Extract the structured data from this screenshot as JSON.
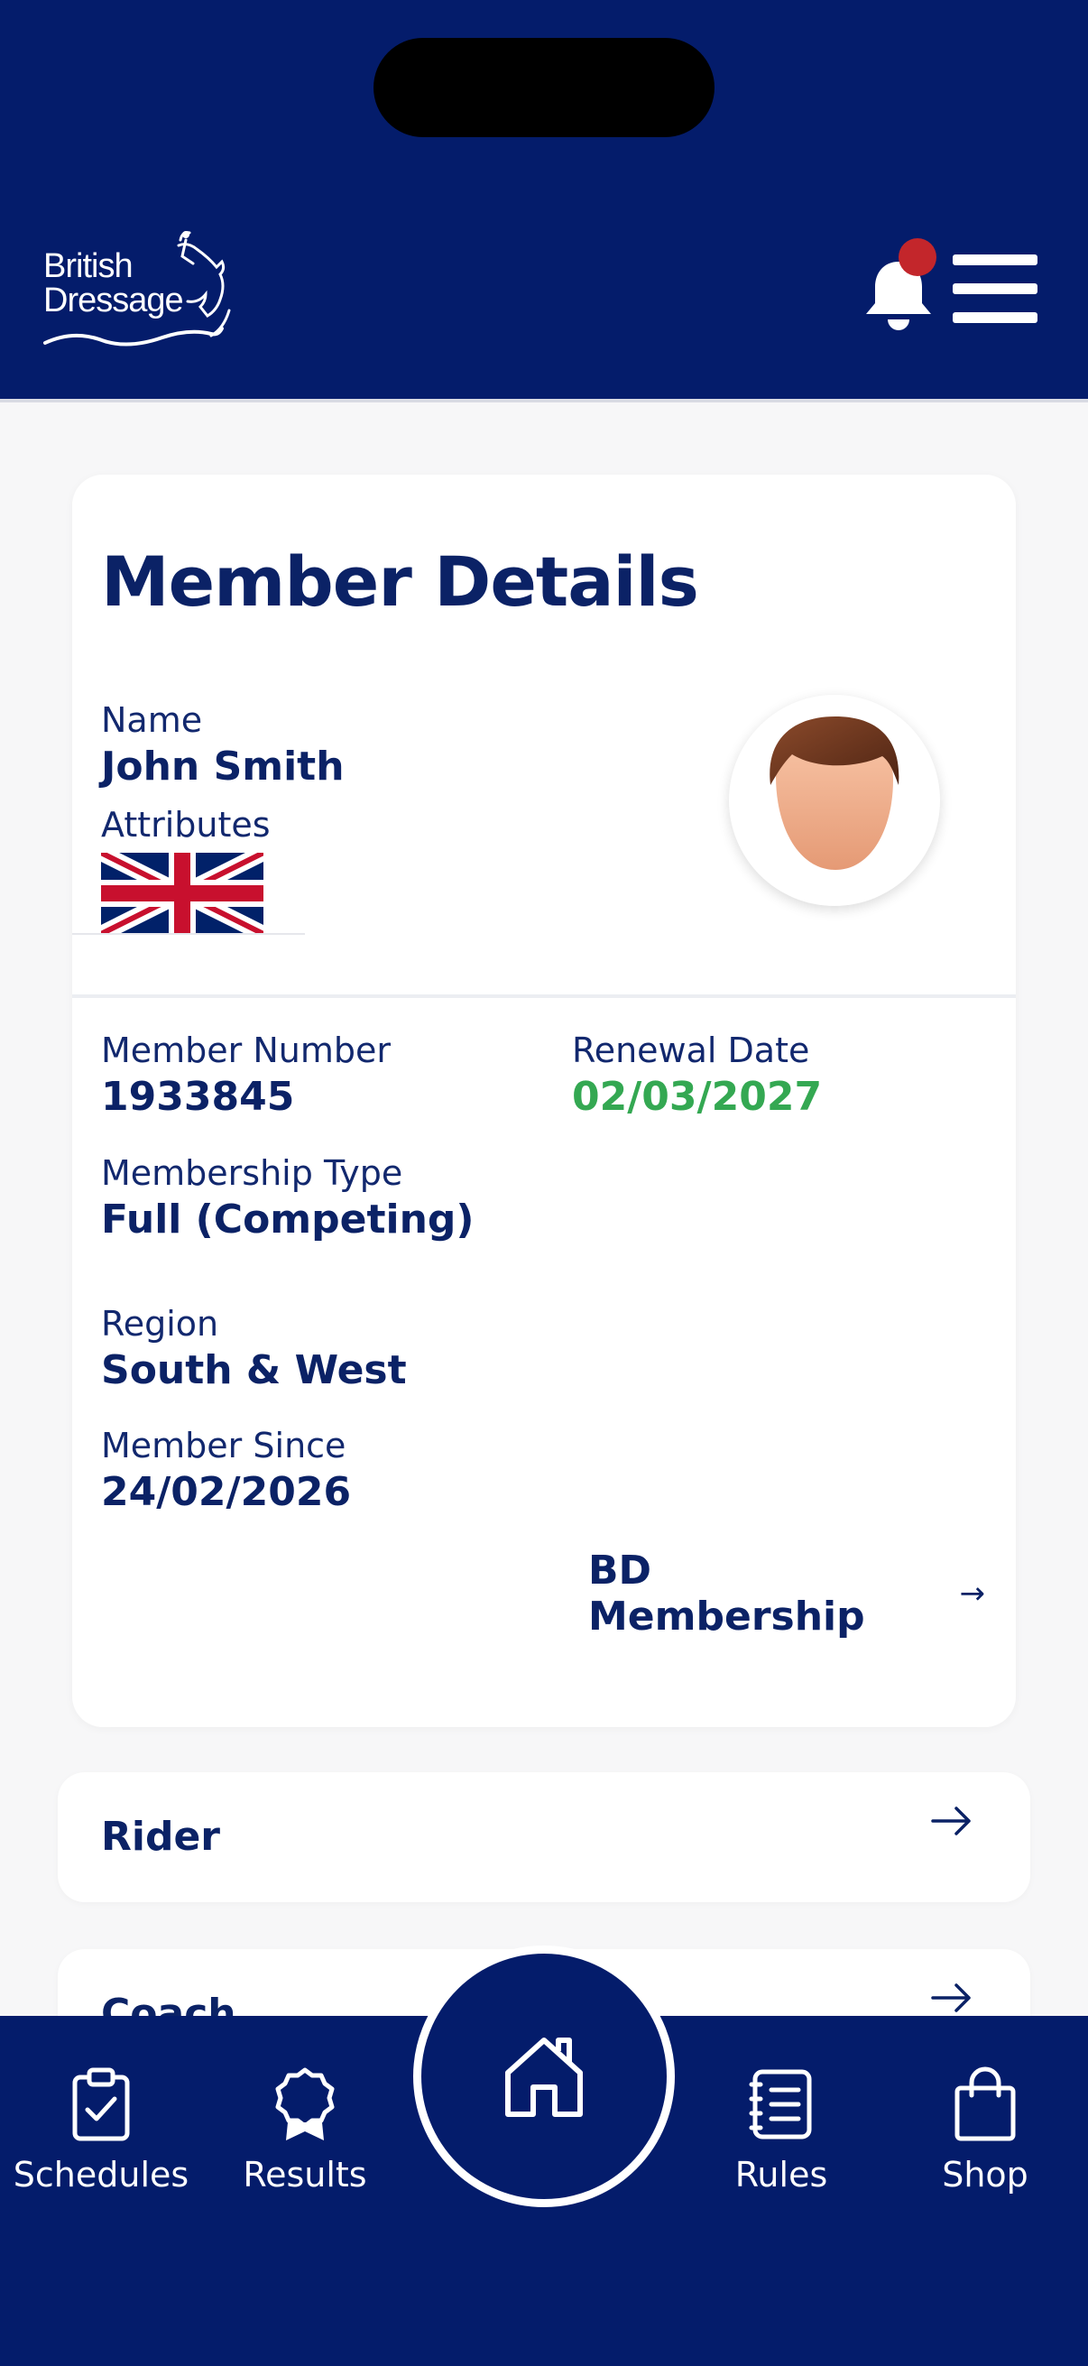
{
  "header": {
    "logo_line1": "British",
    "logo_line2": "Dressage",
    "logo_icon": "dressage-horse-logo",
    "notification_icon": "bell-icon",
    "menu_icon": "hamburger-menu-icon",
    "colors": {
      "header_bg": "#041c6b",
      "notification_dot": "#c3262b"
    }
  },
  "member": {
    "title": "Member Details",
    "name_label": "Name",
    "name": "John Smith",
    "attributes_label": "Attributes",
    "attribute_flag": "uk-flag-icon",
    "number_label": "Member Number",
    "number": "1933845",
    "renewal_label": "Renewal Date",
    "renewal": "02/03/2027",
    "type_label": "Membership Type",
    "type": "Full (Competing)",
    "region_label": "Region",
    "region": "South & West",
    "since_label": "Member Since",
    "since": "24/02/2026",
    "link_label": "BD Membership",
    "link_arrow": "→",
    "colors": {
      "renewal": "#34a852",
      "text": "#0b2266"
    }
  },
  "sections": [
    {
      "label": "Rider"
    },
    {
      "label": "Coach"
    }
  ],
  "nav": {
    "items": [
      {
        "label": "Schedules",
        "icon": "clipboard-check-icon"
      },
      {
        "label": "Results",
        "icon": "rosette-icon"
      },
      {
        "label": "Home",
        "icon": "home-icon"
      },
      {
        "label": "Rules",
        "icon": "rulebook-icon"
      },
      {
        "label": "Shop",
        "icon": "shopping-bag-icon"
      }
    ]
  }
}
